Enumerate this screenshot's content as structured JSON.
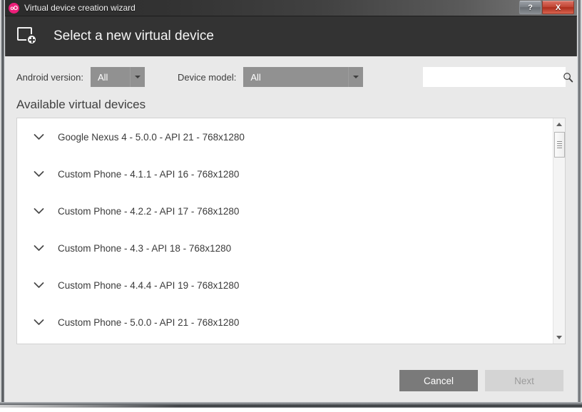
{
  "window": {
    "title": "Virtual device creation wizard",
    "logo_text": "oO",
    "logo_color": "#ec1e79",
    "help_button_label": "?",
    "close_button_label": "X"
  },
  "header": {
    "title": "Select a new virtual device",
    "icon": "add-device-icon",
    "background_color": "#333333"
  },
  "filters": {
    "android_version": {
      "label": "Android version:",
      "value": "All"
    },
    "device_model": {
      "label": "Device model:",
      "value": "All"
    },
    "search": {
      "value": "",
      "placeholder": ""
    }
  },
  "list": {
    "section_title": "Available virtual devices",
    "items": [
      {
        "label": "Google Nexus 4 - 5.0.0 - API 21 - 768x1280"
      },
      {
        "label": "Custom Phone - 4.1.1 - API 16 - 768x1280"
      },
      {
        "label": "Custom Phone - 4.2.2 - API 17 - 768x1280"
      },
      {
        "label": "Custom Phone - 4.3 - API 18 - 768x1280"
      },
      {
        "label": "Custom Phone - 4.4.4 - API 19 - 768x1280"
      },
      {
        "label": "Custom Phone - 5.0.0 - API 21 - 768x1280"
      }
    ]
  },
  "footer": {
    "cancel_label": "Cancel",
    "next_label": "Next"
  }
}
